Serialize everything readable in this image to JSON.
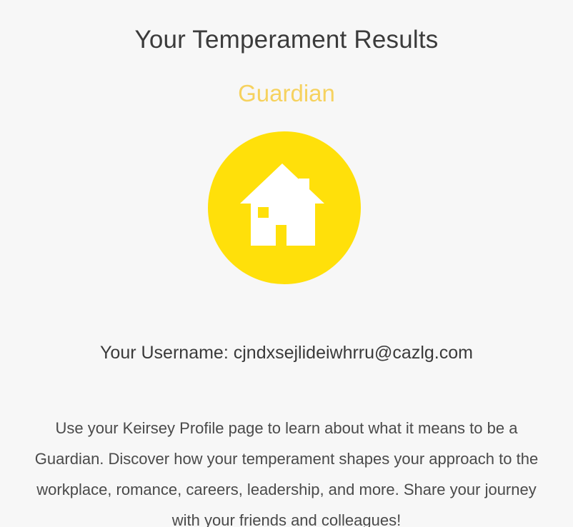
{
  "page": {
    "title": "Your Temperament Results"
  },
  "result": {
    "temperament": "Guardian",
    "icon": "house-icon",
    "accent_color": "#f6d25f",
    "badge_color": "#ffe00a"
  },
  "username": {
    "label": "Your Username:",
    "value": "cjndxsejlideiwhrru@cazlg.com"
  },
  "description": {
    "text": "Use your Keirsey Profile page to learn about what it means to be a Guardian. Discover how your temperament shapes your approach to the workplace, romance, careers, leadership, and more. Share your journey with your friends and colleagues!"
  }
}
